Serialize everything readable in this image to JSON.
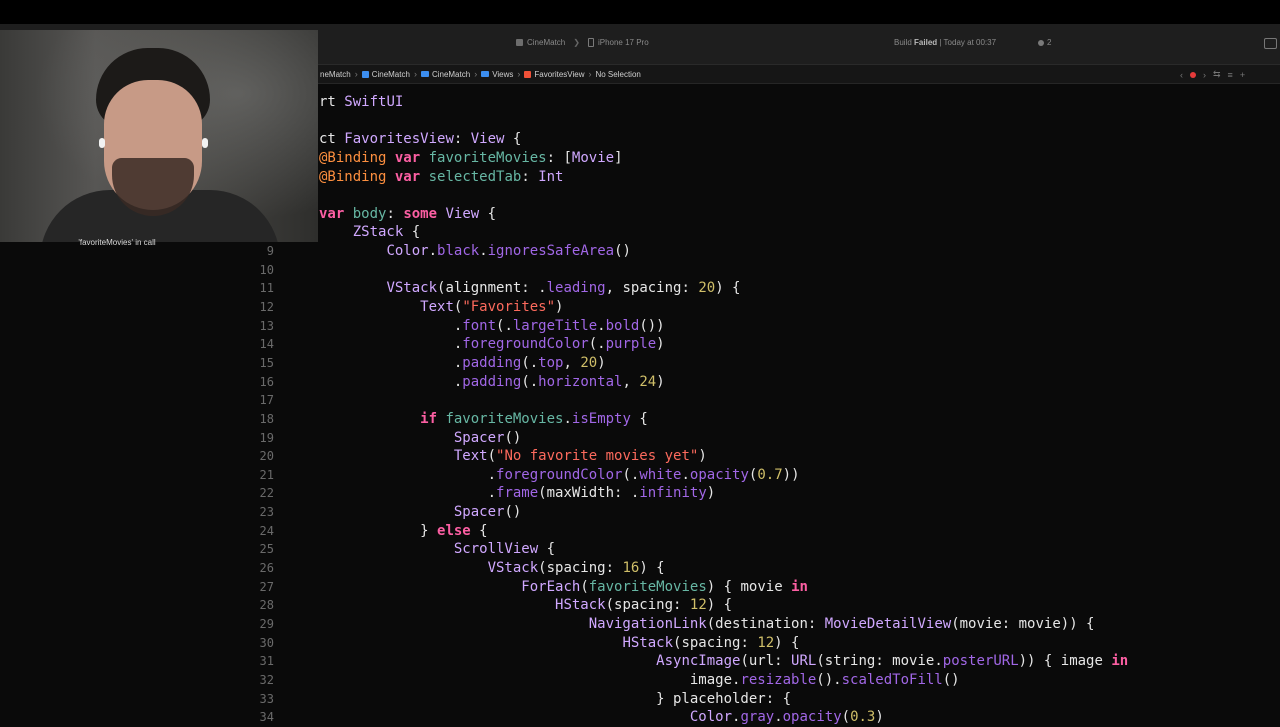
{
  "toolbar": {
    "scheme": "CineMatch",
    "device": "iPhone 17 Pro",
    "status_prefix": "Build",
    "status_state": "Failed",
    "status_time": "| Today at 00:37",
    "issue_count": "2"
  },
  "jumpbar": {
    "crumbs": [
      "neMatch",
      "CineMatch",
      "CineMatch",
      "Views",
      "FavoritesView",
      "No Selection"
    ]
  },
  "webcam": {
    "caption": "'favoriteMovies' in call"
  },
  "editor": {
    "line_numbers": [
      "",
      "",
      "",
      "",
      "",
      "",
      "",
      "",
      "9",
      "10",
      "11",
      "12",
      "13",
      "14",
      "15",
      "16",
      "17",
      "18",
      "19",
      "20",
      "21",
      "22",
      "23",
      "24",
      "25",
      "26",
      "27",
      "28",
      "29",
      "30",
      "31",
      "32",
      "33",
      "34"
    ],
    "lines": [
      "rt SwiftUI",
      "",
      "ct FavoritesView: View {",
      "@Binding var favoriteMovies: [Movie]",
      "@Binding var selectedTab: Int",
      "",
      "var body: some View {",
      "    ZStack {",
      "        Color.black.ignoresSafeArea()",
      "",
      "        VStack(alignment: .leading, spacing: 20) {",
      "            Text(\"Favorites\")",
      "                .font(.largeTitle.bold())",
      "                .foregroundColor(.purple)",
      "                .padding(.top, 20)",
      "                .padding(.horizontal, 24)",
      "",
      "            if favoriteMovies.isEmpty {",
      "                Spacer()",
      "                Text(\"No favorite movies yet\")",
      "                    .foregroundColor(.white.opacity(0.7))",
      "                    .frame(maxWidth: .infinity)",
      "                Spacer()",
      "            } else {",
      "                ScrollView {",
      "                    VStack(spacing: 16) {",
      "                        ForEach(favoriteMovies) { movie in",
      "                            HStack(spacing: 12) {",
      "                                NavigationLink(destination: MovieDetailView(movie: movie)) {",
      "                                    HStack(spacing: 12) {",
      "                                        AsyncImage(url: URL(string: movie.posterURL)) { image in",
      "                                            image.resizable().scaledToFill()",
      "                                        } placeholder: {",
      "                                            Color.gray.opacity(0.3)"
    ]
  }
}
